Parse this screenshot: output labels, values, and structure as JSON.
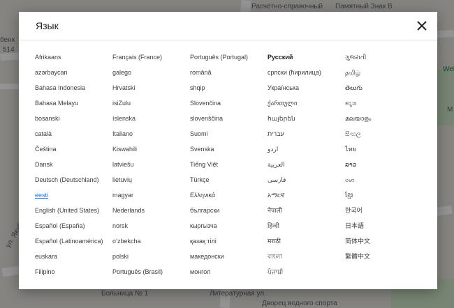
{
  "map": {
    "labels": {
      "top_center": "Расчётно-справочный",
      "top_right": "Памятный Знак В",
      "left_top": "бенк",
      "left_num": "514",
      "right_mid": "Wel",
      "right_m": "M",
      "bottom_left": "ул. Якуба",
      "bottom_center": "Больница № 1",
      "bottom_right": "Дворец водного спорта",
      "bottom_mid": "Литературная ул."
    }
  },
  "dialog": {
    "title": "Язык",
    "close_icon": "close-icon",
    "columns": [
      [
        "Afrikaans",
        "azərbaycan",
        "Bahasa Indonesia",
        "Bahasa Melayu",
        "bosanski",
        "català",
        "Čeština",
        "Dansk",
        "Deutsch (Deutschland)",
        "eesti",
        "English (United States)",
        "Español (España)",
        "Español (Latinoamérica)",
        "euskara",
        "Filipino"
      ],
      [
        "Français (France)",
        "galego",
        "Hrvatski",
        "isiZulu",
        "íslenska",
        "Italiano",
        "Kiswahili",
        "latviešu",
        "lietuvių",
        "magyar",
        "Nederlands",
        "norsk",
        "o‘zbekcha",
        "polski",
        "Português (Brasil)"
      ],
      [
        "Português (Portugal)",
        "română",
        "shqip",
        "Slovenčina",
        "slovenščina",
        "Suomi",
        "Svenska",
        "Tiếng Việt",
        "Türkçe",
        "Ελληνικά",
        "български",
        "кыргызча",
        "қазақ тілі",
        "македонски",
        "монгол"
      ],
      [
        "Русский",
        "српски (ћирилица)",
        "Українська",
        "ქართული",
        "հայերեն",
        "עברית",
        "اردو",
        "العربية",
        "فارسی",
        "አማርኛ",
        "नेपाली",
        "हिन्दी",
        "मराठी",
        "বাংলা",
        "ਪੰਜਾਬੀ"
      ],
      [
        "ગુજરાતી",
        "தமிழ்",
        "తెలుగు",
        "ಕನ್ನಡ",
        "മലയാളം",
        "සිංහල",
        "ไทย",
        "ລາວ",
        "ဗမာ",
        "ខ្មែរ",
        "한국어",
        "日本語",
        "简体中文",
        "繁體中文"
      ]
    ],
    "selected": "Русский",
    "link": "eesti"
  }
}
